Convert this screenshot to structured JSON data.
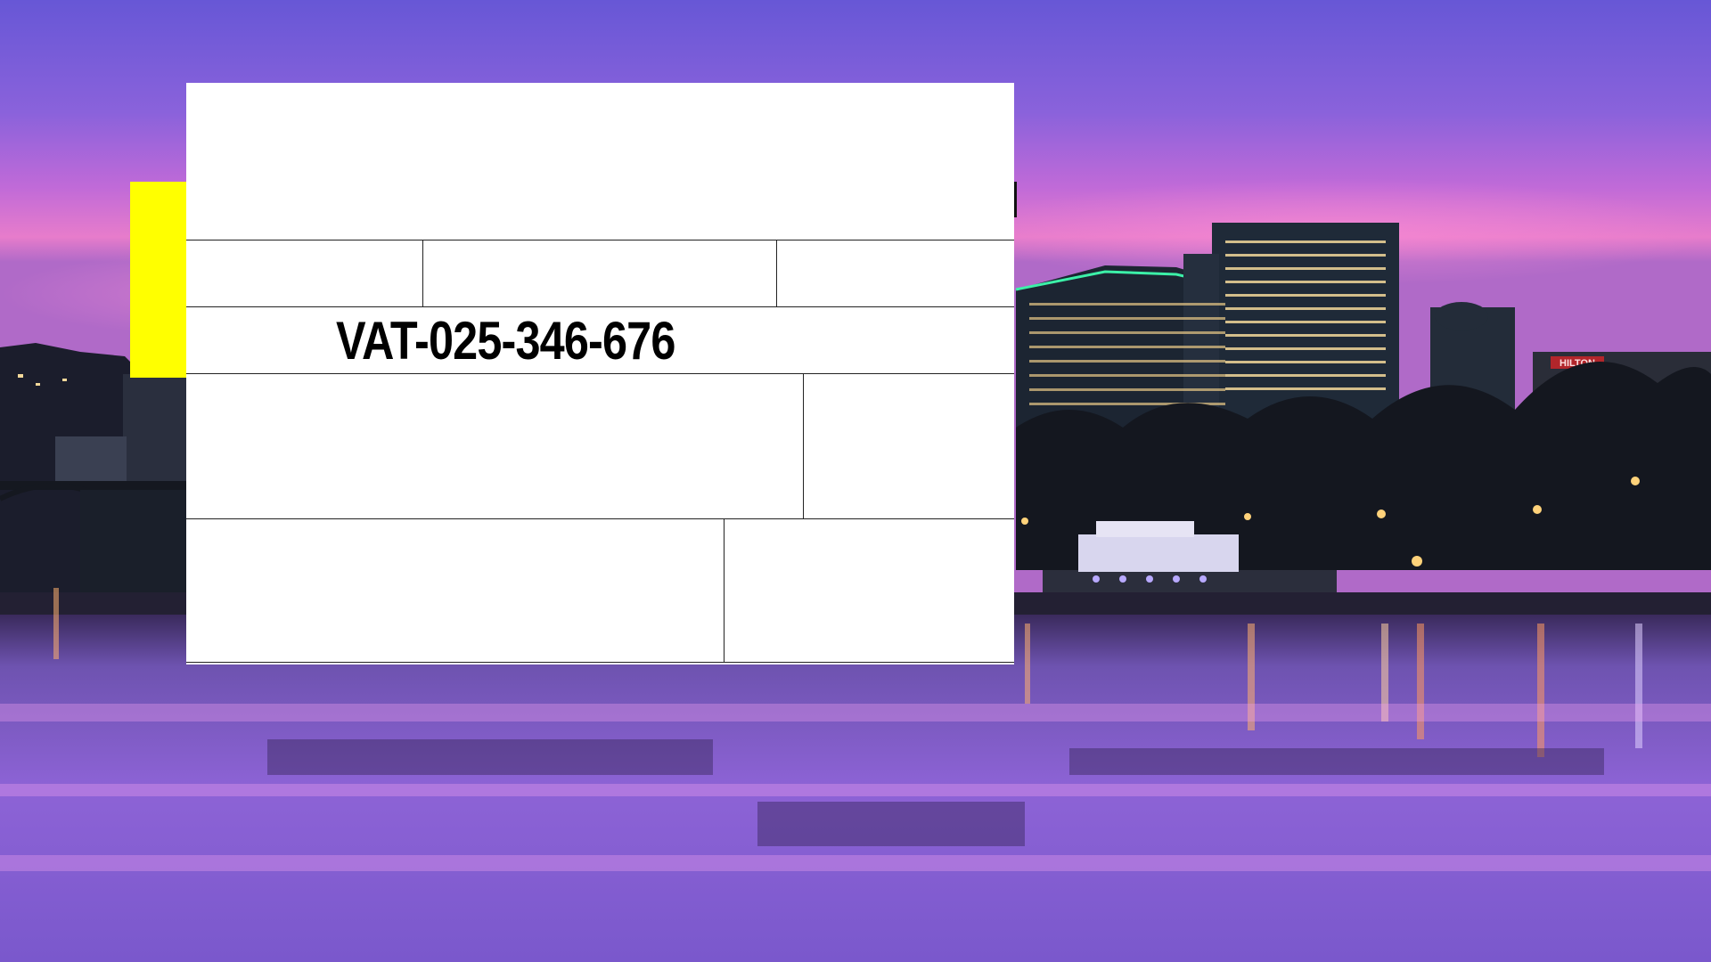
{
  "background": {
    "scene": "city skyline at dusk over river",
    "sky_top": "#6a5ad8",
    "sky_mid": "#c46bd9",
    "sky_glow": "#f07ac8",
    "water": "#8a5fd6",
    "building_dark": "#1b2430",
    "building_lit": "#f3d89a",
    "building_sign_text": "HILTON"
  },
  "accent": {
    "color": "#ffff00"
  },
  "form": {
    "vat_number": "VAT-025-346-676",
    "background": "#ffffff",
    "border_color": "#222222"
  }
}
